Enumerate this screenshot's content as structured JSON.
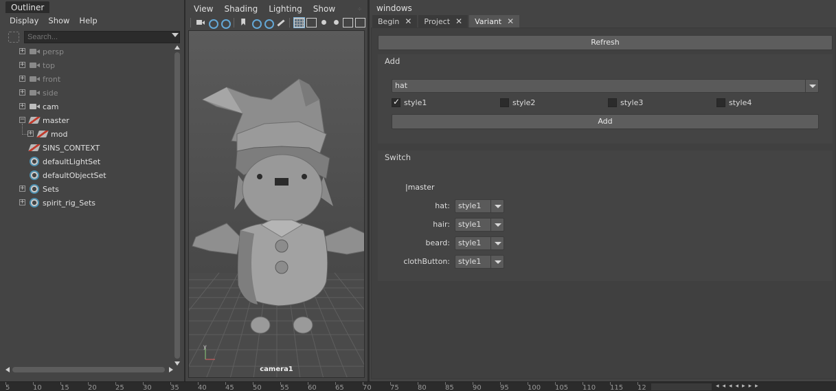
{
  "outliner": {
    "tab_label": "Outliner",
    "menu": [
      "Display",
      "Show",
      "Help"
    ],
    "search_placeholder": "Search...",
    "nodes": [
      {
        "label": "persp",
        "icon": "camera-icon",
        "expandable": true,
        "dim": true,
        "indent": 0
      },
      {
        "label": "top",
        "icon": "camera-icon",
        "expandable": true,
        "dim": true,
        "indent": 0
      },
      {
        "label": "front",
        "icon": "camera-icon",
        "expandable": true,
        "dim": true,
        "indent": 0
      },
      {
        "label": "side",
        "icon": "camera-icon",
        "expandable": true,
        "dim": true,
        "indent": 0
      },
      {
        "label": "cam",
        "icon": "camera-icon",
        "expandable": true,
        "dim": false,
        "indent": 0
      },
      {
        "label": "master",
        "icon": "transform-icon",
        "expandable": true,
        "expanded": true,
        "dim": false,
        "indent": 0
      },
      {
        "label": "mod",
        "icon": "transform-icon",
        "expandable": true,
        "dim": false,
        "indent": 1
      },
      {
        "label": "SINS_CONTEXT",
        "icon": "transform-icon",
        "expandable": false,
        "dim": false,
        "indent": 0
      },
      {
        "label": "defaultLightSet",
        "icon": "set-icon",
        "expandable": false,
        "dim": false,
        "indent": 0
      },
      {
        "label": "defaultObjectSet",
        "icon": "set-icon",
        "expandable": false,
        "dim": false,
        "indent": 0
      },
      {
        "label": "Sets",
        "icon": "set-icon",
        "expandable": true,
        "dim": false,
        "indent": 0
      },
      {
        "label": "spirit_rig_Sets",
        "icon": "set-icon",
        "expandable": true,
        "dim": false,
        "indent": 0
      }
    ]
  },
  "viewport": {
    "menu": [
      "View",
      "Shading",
      "Lighting",
      "Show"
    ],
    "camera_label": "camera1",
    "axis_y": "y"
  },
  "windows": {
    "title": "windows",
    "tabs": [
      {
        "label": "Begin",
        "active": false
      },
      {
        "label": "Project",
        "active": false
      },
      {
        "label": "Variant",
        "active": true
      }
    ],
    "refresh_label": "Refresh",
    "add_group": {
      "title": "Add",
      "category_value": "hat",
      "styles": [
        {
          "label": "style1",
          "checked": true
        },
        {
          "label": "style2",
          "checked": false
        },
        {
          "label": "style3",
          "checked": false
        },
        {
          "label": "style4",
          "checked": false
        }
      ],
      "add_label": "Add"
    },
    "switch_group": {
      "title": "Switch",
      "node_path": "|master",
      "rows": [
        {
          "label": "hat:",
          "value": "style1"
        },
        {
          "label": "hair:",
          "value": "style1"
        },
        {
          "label": "beard:",
          "value": "style1"
        },
        {
          "label": "clothButton:",
          "value": "style1"
        }
      ]
    }
  },
  "timeline": {
    "ticks": [
      "5",
      "10",
      "15",
      "20",
      "25",
      "30",
      "35",
      "40",
      "45",
      "50",
      "55",
      "60",
      "65",
      "70",
      "75",
      "80",
      "85",
      "90",
      "95",
      "100",
      "105",
      "110",
      "115",
      "12"
    ]
  },
  "colors": {
    "panel": "#444444",
    "dark": "#2b2b2b",
    "button": "#5d5d5d",
    "accent_blue": "#64a8d6",
    "accent_red": "#c0392b"
  }
}
